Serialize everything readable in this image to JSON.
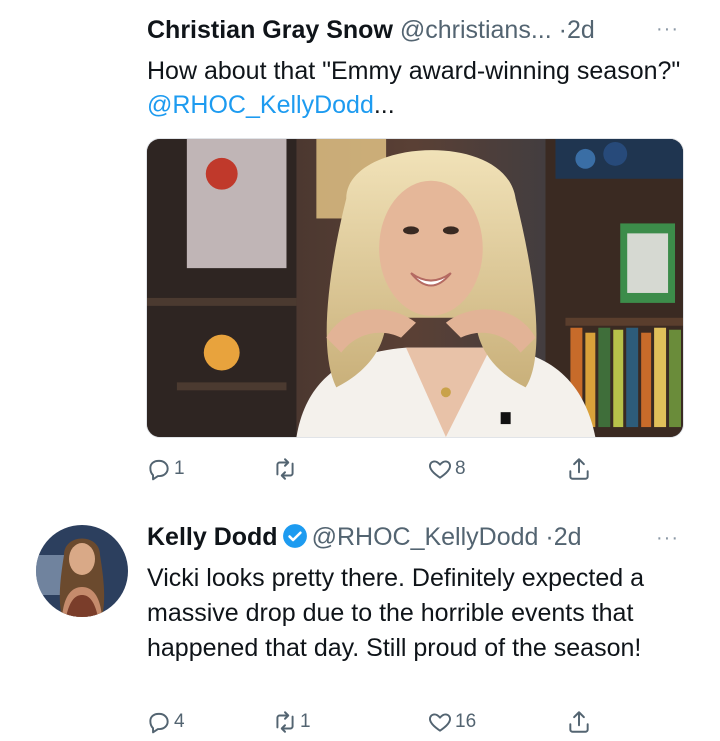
{
  "tweets": [
    {
      "author_name": "Christian Gray Snow",
      "handle": "@christians...",
      "dot": "·",
      "time": "2d",
      "more_label": "···",
      "text_before": "How about that \"Emmy award-winning season?\" ",
      "mention": "@RHOC_KellyDodd",
      "text_after": "...",
      "has_media": true,
      "media_icon": "photo-woman-talk-show-set",
      "actions": {
        "reply_count": "1",
        "retweet_count": "",
        "like_count": "8"
      }
    },
    {
      "author_name": "Kelly Dodd",
      "verified": true,
      "handle": "@RHOC_KellyDodd",
      "dot": "·",
      "time": "2d",
      "more_label": "···",
      "text": "Vicki looks pretty there. Definitely expected a massive drop due to the horrible events that happened that day. Still proud of the season!",
      "avatar_icon": "profile-photo-woman",
      "actions": {
        "reply_count": "4",
        "retweet_count": "1",
        "like_count": "16"
      }
    }
  ],
  "colors": {
    "link": "#1d9bf0",
    "secondary": "#536471",
    "verified": "#1d9bf0"
  }
}
